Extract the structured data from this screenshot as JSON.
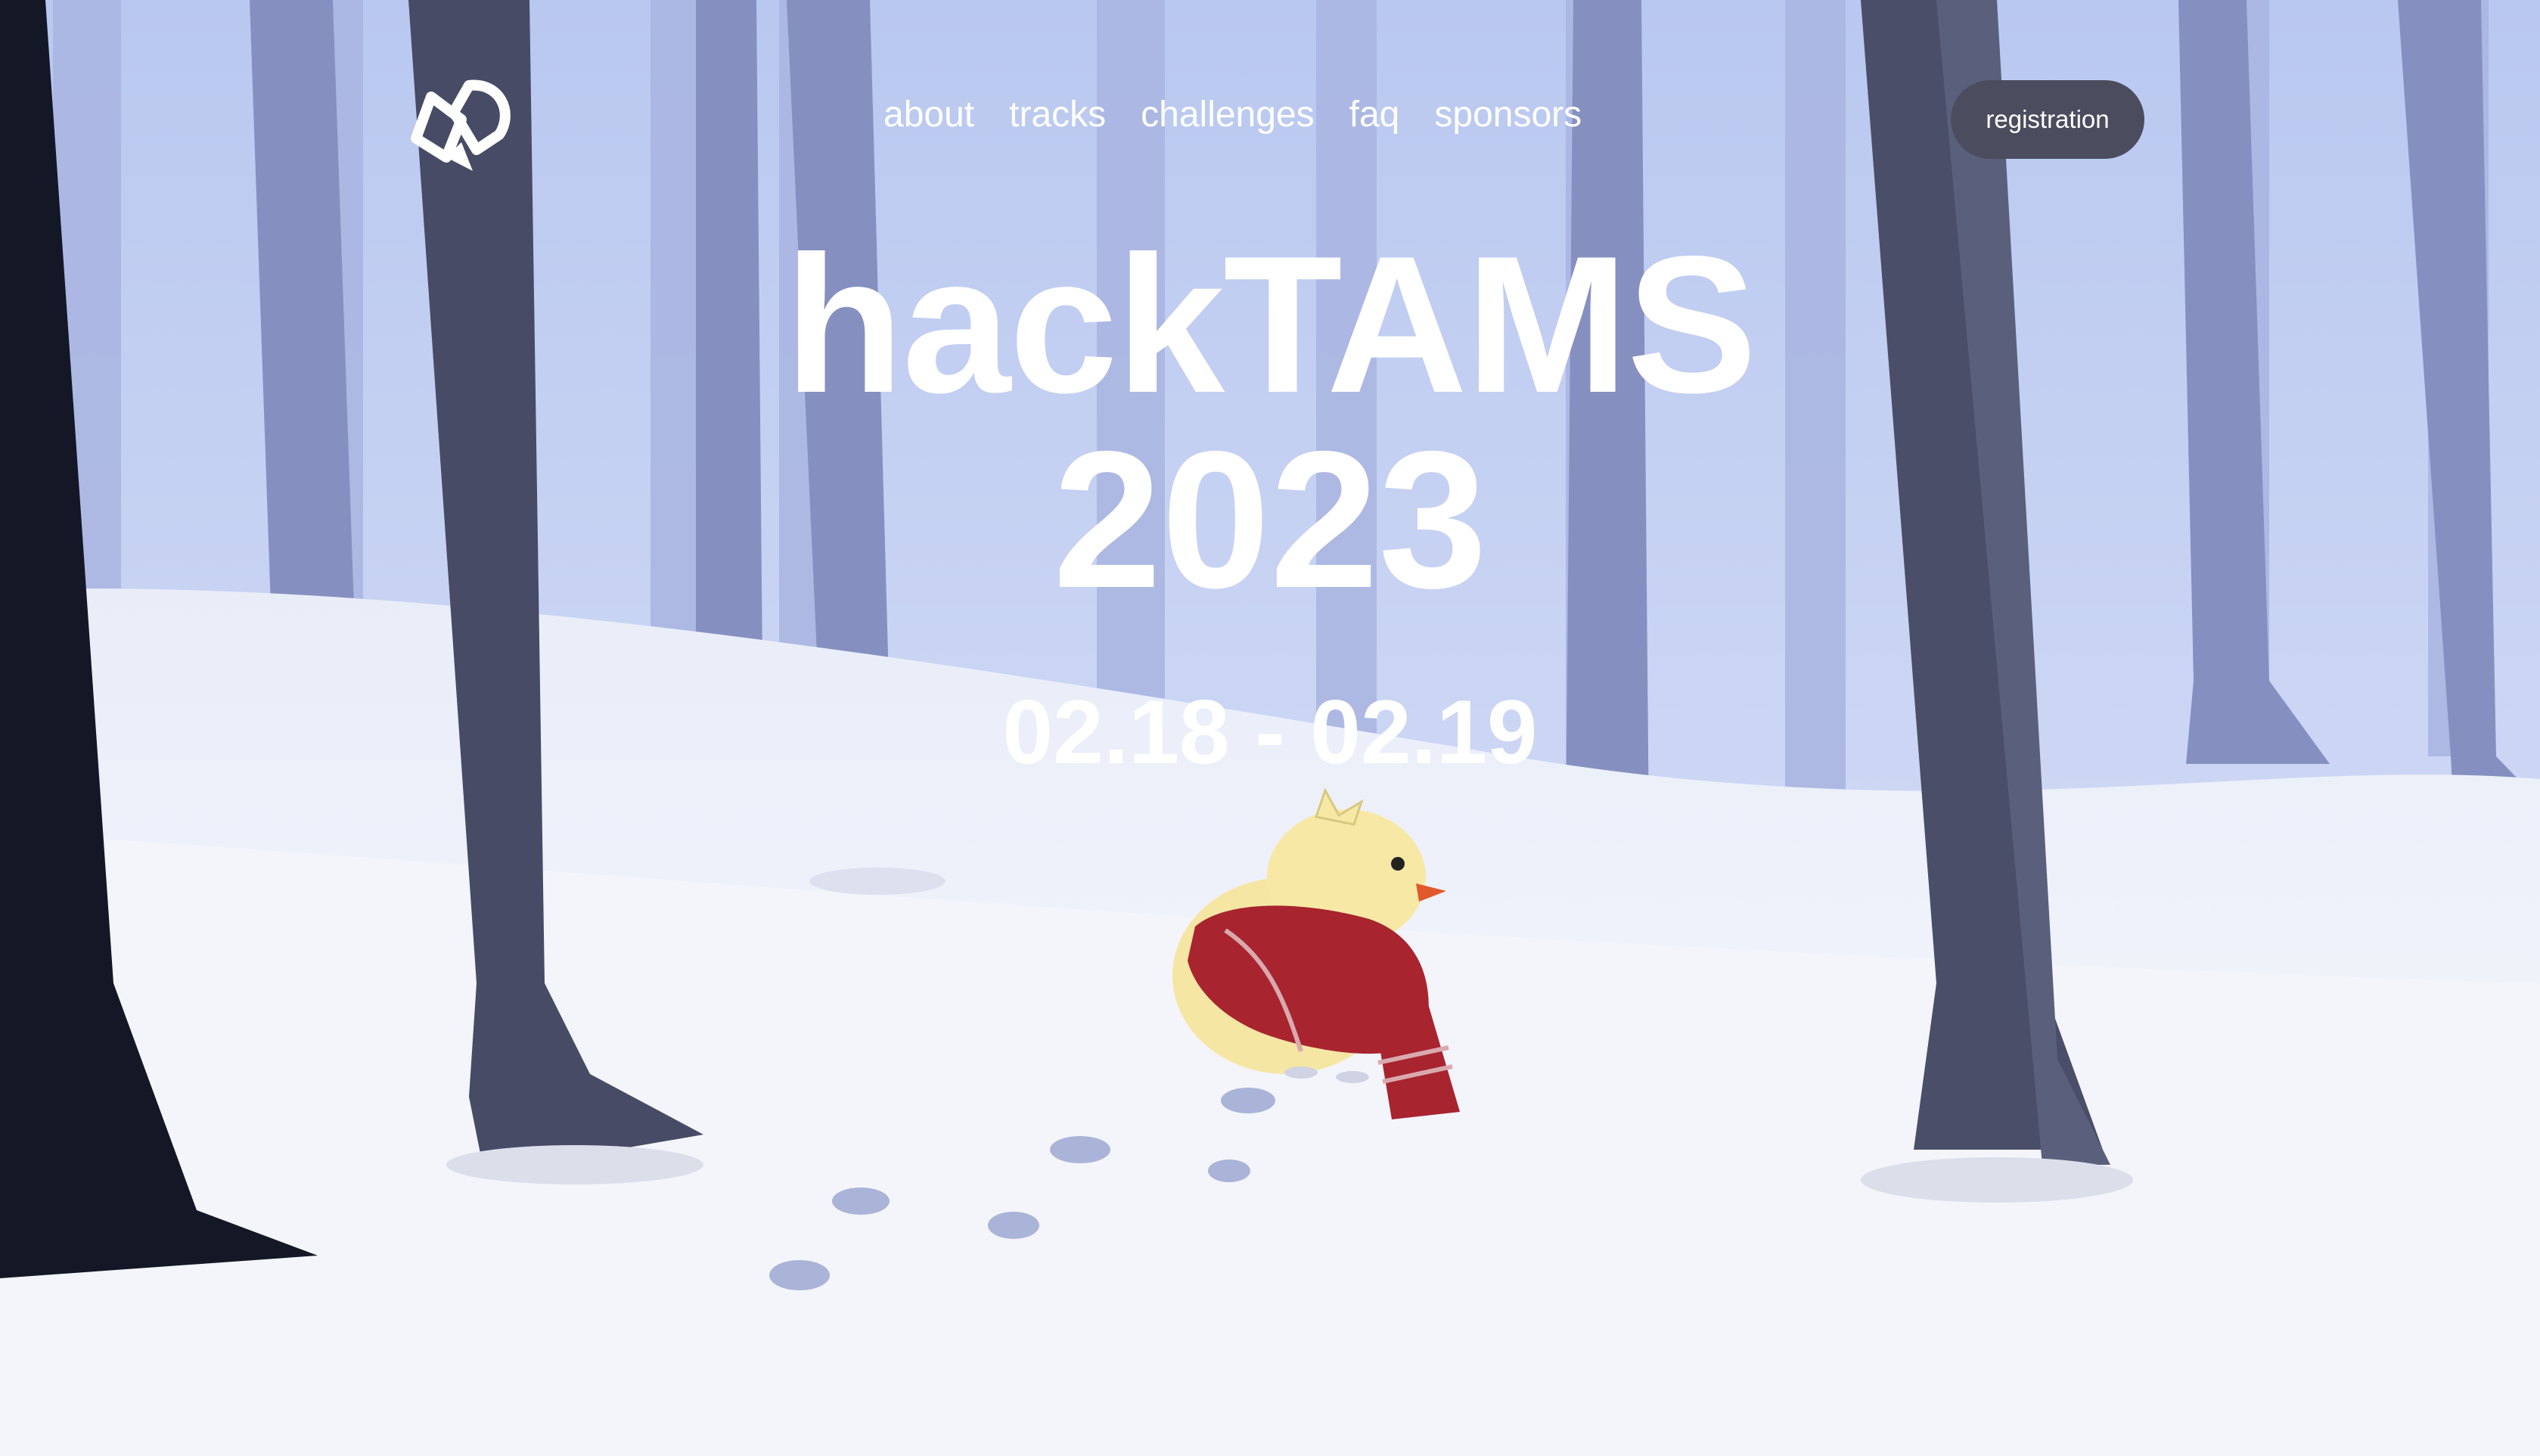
{
  "nav": {
    "logo_icon": "hacktams-logo-icon",
    "links": [
      {
        "label": "about"
      },
      {
        "label": "tracks"
      },
      {
        "label": "challenges"
      },
      {
        "label": "faq"
      },
      {
        "label": "sponsors"
      }
    ],
    "register_label": "registration"
  },
  "hero": {
    "title": "hackTAMS",
    "year": "2023",
    "dates": "02.18 - 02.19"
  },
  "scene": {
    "illustration": "winter-forest-chick-illustration",
    "colors": {
      "sky": "#c3cff0",
      "snow": "#f4f6fc",
      "tree_dark": "#454963",
      "tree_mid": "#7a84b4",
      "tree_far": "#a9b5e0",
      "scarf": "#a8242e",
      "chick": "#f7e6a0",
      "button_bg": "#4b4d5e"
    }
  }
}
